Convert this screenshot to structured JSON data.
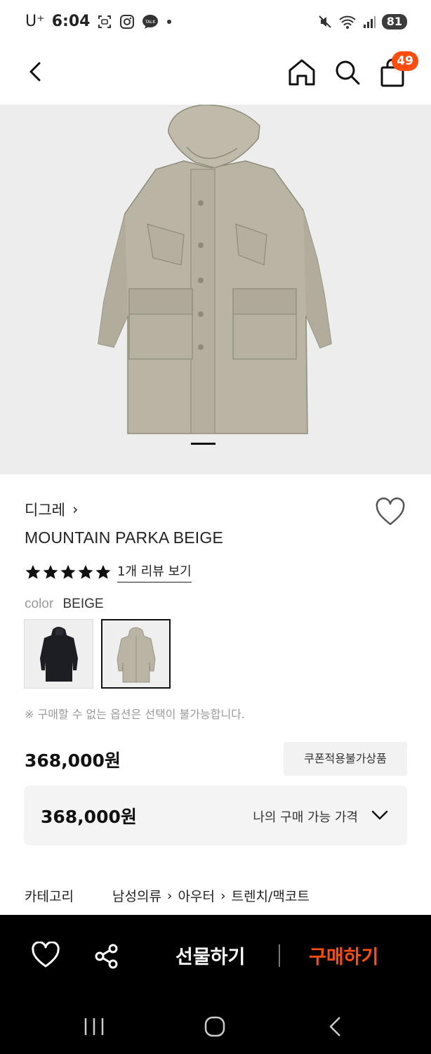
{
  "status_bar": {
    "carrier": "U⁺",
    "time": "6:04",
    "battery": "81"
  },
  "nav": {
    "cart_count": "49"
  },
  "product": {
    "brand": "디그레",
    "brand_chevron": "›",
    "name": "MOUNTAIN PARKA BEIGE",
    "rating": 5,
    "review_link": "1개 리뷰 보기",
    "color_key": "color",
    "color_value": "BEIGE",
    "swatches": [
      {
        "color": "black",
        "selected": false
      },
      {
        "color": "beige",
        "selected": true
      }
    ],
    "notice": "※ 구매할 수 없는 옵션은 선택이 불가능합니다.",
    "price": "368,000원",
    "coupon_badge": "쿠폰적용불가상품",
    "my_price": "368,000원",
    "my_price_label": "나의 구매 가능 가격",
    "category_label": "카테고리",
    "category_path": [
      "남성의류",
      "아우터",
      "트렌치/맥코트"
    ],
    "category_sep": "›"
  },
  "bottom_bar": {
    "gift_label": "선물하기",
    "buy_label": "구매하기",
    "accent": "#FF4D10"
  }
}
